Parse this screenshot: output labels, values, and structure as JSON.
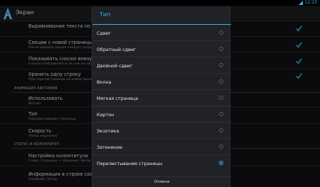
{
  "status_bar": {
    "time": "12:23"
  },
  "app": {
    "title": "Экран",
    "icon": "app-letter-a-icon"
  },
  "settings": {
    "rows": [
      {
        "title": "Выравнивание текста по шир",
        "subtitle": "...",
        "checked": true
      },
      {
        "title": "Секции с новой страницы",
        "subtitle": "После каждой секции следует разрыв",
        "checked": true
      },
      {
        "title": "Показывать сноски внизу текс",
        "subtitle": "Сноски отображаются на том же экра",
        "checked": true
      },
      {
        "title": "Хранить одну строку",
        "subtitle": "При перелистывании на новом экран",
        "checked": true
      }
    ],
    "section_animation": "АНИМАЦИЯ ЛИСТАНИЯ",
    "anim_rows": [
      {
        "title": "Использовать",
        "subtitle": "Всегда"
      },
      {
        "title": "Тип",
        "subtitle": "Перелистывание страницы"
      },
      {
        "title": "Скорость",
        "subtitle": "Очень медленно"
      }
    ],
    "section_status": "СТАТУС И КОЛОНТИТУЛ",
    "status_rows": [
      {
        "title": "Настройка колонтитула",
        "subtitle": "Глава, страницы + Название, Автор"
      },
      {
        "title": "Информация в строке состоя",
        "subtitle": "Название, Автор"
      }
    ]
  },
  "dialog": {
    "title": "Тип",
    "options": [
      {
        "label": "Сдвиг",
        "selected": false
      },
      {
        "label": "Обратный сдвиг",
        "selected": false
      },
      {
        "label": "Двойной сдвиг",
        "selected": false
      },
      {
        "label": "Волна",
        "selected": false
      },
      {
        "label": "Мягкая страница",
        "selected": false
      },
      {
        "label": "Картон",
        "selected": false
      },
      {
        "label": "Экзотика",
        "selected": false
      },
      {
        "label": "Затенение",
        "selected": false
      },
      {
        "label": "Перелистывание страницы",
        "selected": true
      }
    ],
    "cancel_label": "Отмена"
  },
  "colors": {
    "accent": "#33b5e5",
    "background": "#111214",
    "dialog": "#202226"
  }
}
